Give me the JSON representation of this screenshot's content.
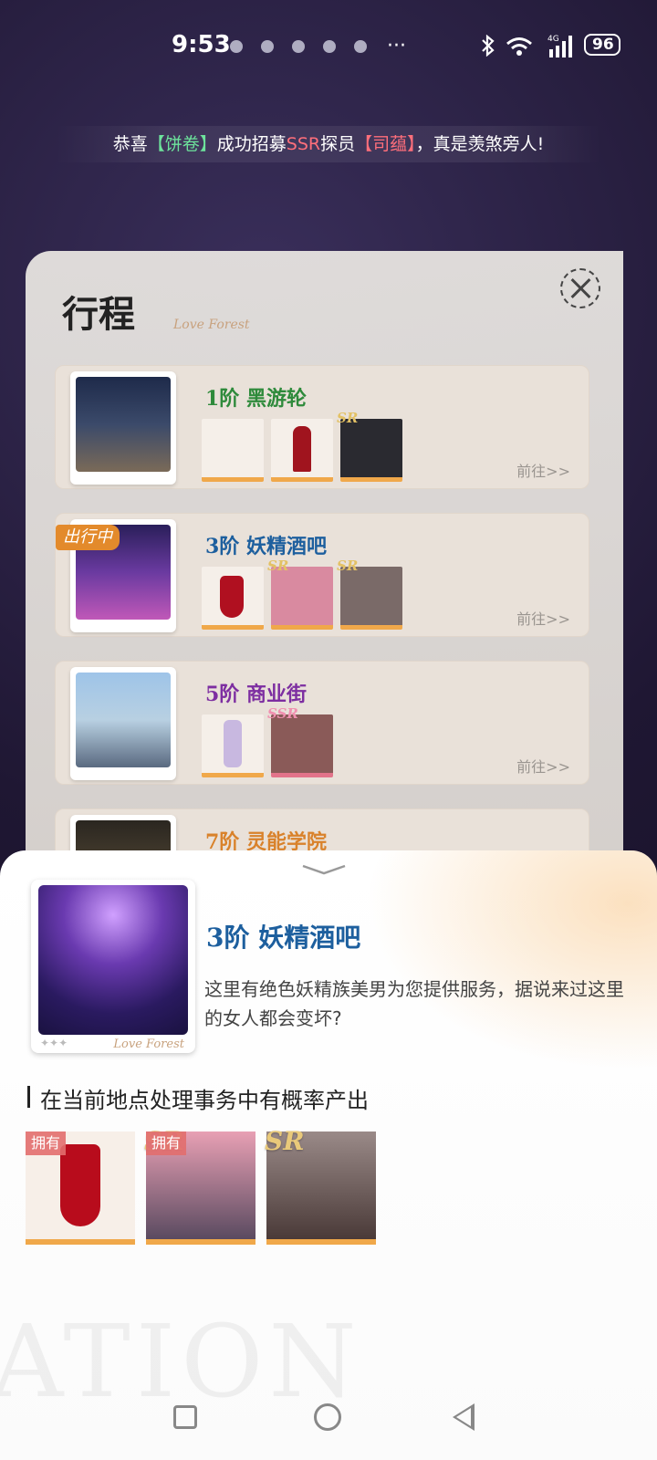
{
  "status": {
    "time": "9:53",
    "more": "···",
    "battery": "96"
  },
  "marquee": {
    "prefix": "恭喜",
    "player": "【饼卷】",
    "middle": "成功招募",
    "rarity": "SSR",
    "mid2": "探员",
    "char": "【司蕴】",
    "suffix": "，真是羡煞旁人!"
  },
  "panel": {
    "title": "行程",
    "watermark": "Love Forest",
    "locations": [
      {
        "name": "1阶 黑游轮",
        "color": "#2e8a3b",
        "goto": "前往>>",
        "items": [
          "white-dress",
          "red-dress",
          "card-couple"
        ],
        "sr": [
          false,
          false,
          true
        ]
      },
      {
        "name": "3阶 妖精酒吧",
        "color": "#1d5f9e",
        "goto": "前往>>",
        "busy": "出行中",
        "items": [
          "red-dress",
          "card-pink",
          "card-kiss"
        ],
        "sr": [
          false,
          true,
          true
        ]
      },
      {
        "name": "5阶 商业街",
        "color": "#7d2ea1",
        "goto": "前往>>",
        "items": [
          "lilac-outfit",
          "card-ssr"
        ],
        "sr": [
          false,
          true
        ]
      },
      {
        "name": "7阶 灵能学院",
        "color": "#d9822b"
      }
    ],
    "sr_label": "SR",
    "ssr_label": "SSR"
  },
  "sheet": {
    "name": "3阶 妖精酒吧",
    "desc": "这里有绝色妖精族美男为您提供服务，据说来过这里的女人都会变坏?",
    "sub": "在当前地点处理事务中有概率产出",
    "own": "拥有",
    "sr": "SR",
    "card_foot": "✦✦✦",
    "card_sig": "Love Forest",
    "ghost": "ATION"
  },
  "colors": {
    "accent_orange": "#f0a84a",
    "title_blue": "#1d5f9e"
  }
}
